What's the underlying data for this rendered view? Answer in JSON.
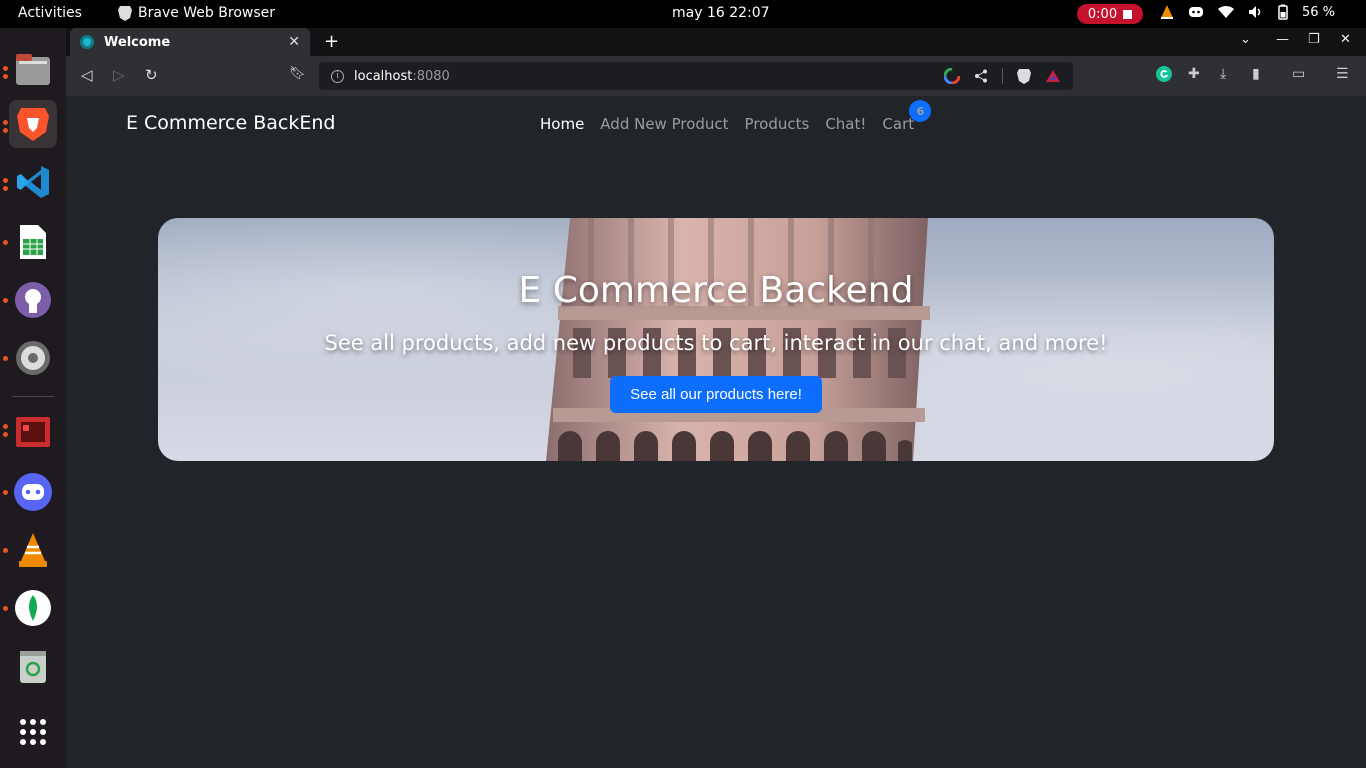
{
  "topbar": {
    "activities": "Activities",
    "app_name": "Brave Web Browser",
    "clock": "may 16  22:07",
    "recording": "0:00",
    "battery": "56 %"
  },
  "dock": {
    "items": [
      "files-icon",
      "brave-icon",
      "vscode-icon",
      "spreadsheet-icon",
      "github-icon",
      "settings-icon",
      "screen-recorder-icon",
      "discord-icon",
      "vlc-icon",
      "mongodb-icon",
      "trash-icon",
      "app-grid-icon"
    ]
  },
  "browser": {
    "tab_title": "Welcome",
    "url_host": "localhost",
    "url_port": ":8080"
  },
  "navbar": {
    "brand": "E Commerce BackEnd",
    "links": [
      "Home",
      "Add New Product",
      "Products",
      "Chat!",
      "Cart"
    ],
    "cart_count": "6"
  },
  "hero": {
    "title": "E Commerce Backend",
    "subtitle": "See all products, add new products to cart, interact in our chat, and more!",
    "button": "See all our products here!"
  },
  "colors": {
    "page_bg": "#212529",
    "primary": "#0d6efd",
    "recording": "#c4112e",
    "dock_bg": "#1f1a20"
  }
}
